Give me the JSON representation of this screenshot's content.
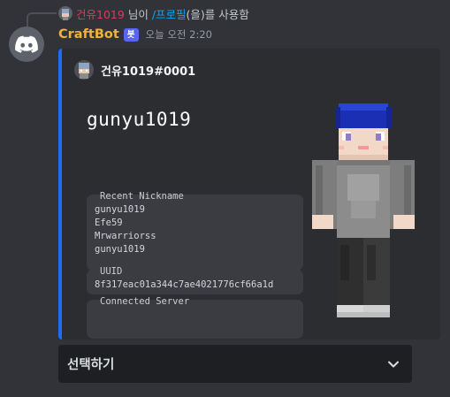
{
  "reply": {
    "username": "건유1019",
    "mid_text": "님이",
    "command": "/프로필",
    "tail_text": "(을)를 사용함"
  },
  "message": {
    "bot_name": "CraftBot",
    "bot_tag": "봇",
    "timestamp": "오늘 오전 2:20"
  },
  "embed": {
    "author": "건유1019#0001",
    "accent_color": "#1e6cf2",
    "profile": {
      "player_name": "gunyu1019",
      "recent_nickname_label": "Recent Nickname",
      "recent_nicknames": [
        "gunyu1019",
        "Efe59",
        "Mrwarriorss",
        "gunyu1019"
      ],
      "uuid_label": "UUID",
      "uuid": "8f317eac01a344c7ae4021776cf66a1d",
      "server_label": "Connected Server",
      "server": ""
    }
  },
  "select_menu": {
    "placeholder": "선택하기",
    "icon": "chevron-down-icon"
  }
}
